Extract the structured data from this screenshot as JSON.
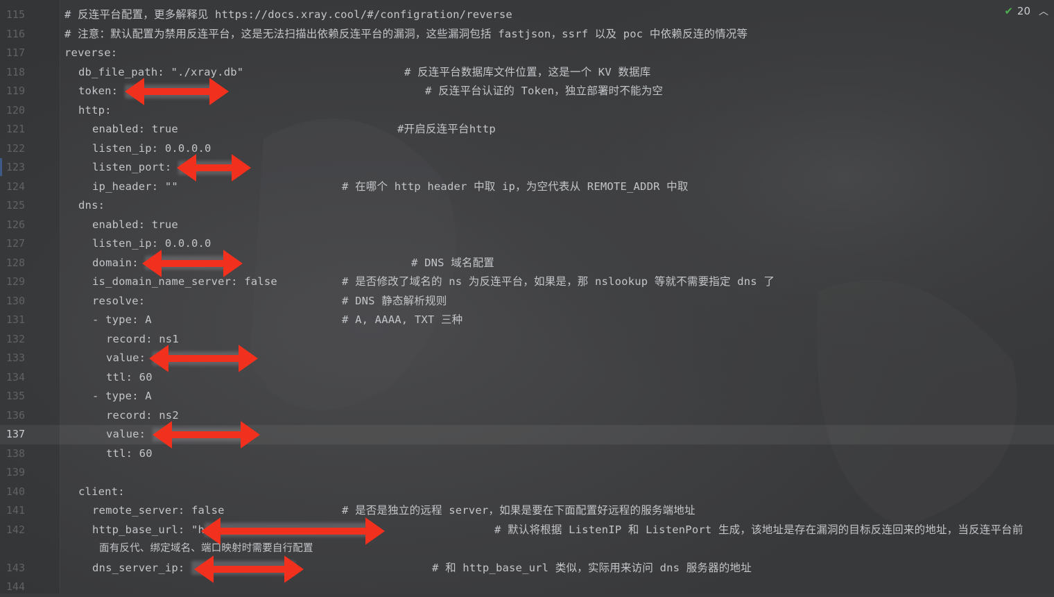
{
  "inspection": {
    "count": "20",
    "check_icon": "check-icon",
    "chevron_icon": "chevron-up-icon"
  },
  "lines": [
    {
      "n": "115",
      "indent": 0,
      "code": "# 反连平台配置，更多解释见 https://docs.xray.cool/#/configration/reverse",
      "comment": "",
      "comment_x": 0
    },
    {
      "n": "116",
      "indent": 0,
      "code": "# 注意：默认配置为禁用反连平台，这是无法扫描出依赖反连平台的漏洞，这些漏洞包括 fastjson，ssrf 以及 poc 中依赖反连的情况等",
      "comment": ""
    },
    {
      "n": "117",
      "indent": 0,
      "code": "reverse:",
      "comment": ""
    },
    {
      "n": "118",
      "indent": 1,
      "code": "db_file_path: \"./xray.db\"",
      "comment": "# 反连平台数据库文件位置，这是一个 KV 数据库"
    },
    {
      "n": "119",
      "indent": 1,
      "code": "token: ",
      "comment": "# 反连平台认证的 Token，独立部署时不能为空"
    },
    {
      "n": "120",
      "indent": 1,
      "code": "http:",
      "comment": ""
    },
    {
      "n": "121",
      "indent": 2,
      "code": "enabled: true",
      "comment": "#开启反连平台http"
    },
    {
      "n": "122",
      "indent": 2,
      "code": "listen_ip: 0.0.0.0",
      "comment": ""
    },
    {
      "n": "123",
      "indent": 2,
      "code": "listen_port: ",
      "comment": ""
    },
    {
      "n": "124",
      "indent": 2,
      "code": "ip_header: \"\"",
      "comment": "# 在哪个 http header 中取 ip，为空代表从 REMOTE_ADDR 中取"
    },
    {
      "n": "125",
      "indent": 1,
      "code": "dns:",
      "comment": ""
    },
    {
      "n": "126",
      "indent": 2,
      "code": "enabled: true",
      "comment": ""
    },
    {
      "n": "127",
      "indent": 2,
      "code": "listen_ip: 0.0.0.0",
      "comment": ""
    },
    {
      "n": "128",
      "indent": 2,
      "code": "domain: ",
      "comment": "# DNS 域名配置"
    },
    {
      "n": "129",
      "indent": 2,
      "code": "is_domain_name_server: false",
      "comment": "# 是否修改了域名的 ns 为反连平台，如果是，那 nslookup 等就不需要指定 dns 了"
    },
    {
      "n": "130",
      "indent": 2,
      "code": "resolve:",
      "comment": "# DNS 静态解析规则"
    },
    {
      "n": "131",
      "indent": 2,
      "code": "- type: A",
      "comment": "# A, AAAA, TXT 三种"
    },
    {
      "n": "132",
      "indent": 3,
      "code": "record: ns1",
      "comment": ""
    },
    {
      "n": "133",
      "indent": 3,
      "code": "value: ",
      "comment": ""
    },
    {
      "n": "134",
      "indent": 3,
      "code": "ttl: 60",
      "comment": ""
    },
    {
      "n": "135",
      "indent": 2,
      "code": "- type: A",
      "comment": ""
    },
    {
      "n": "136",
      "indent": 3,
      "code": "record: ns2",
      "comment": ""
    },
    {
      "n": "137",
      "indent": 3,
      "code": "value: ",
      "comment": ""
    },
    {
      "n": "138",
      "indent": 3,
      "code": "ttl: 60",
      "comment": ""
    },
    {
      "n": "139",
      "indent": 0,
      "code": "",
      "comment": ""
    },
    {
      "n": "140",
      "indent": 1,
      "code": "client:",
      "comment": ""
    },
    {
      "n": "141",
      "indent": 2,
      "code": "remote_server: false",
      "comment": "# 是否是独立的远程 server，如果是要在下面配置好远程的服务端地址"
    },
    {
      "n": "142",
      "indent": 2,
      "code": "http_base_url: \"h",
      "comment": "# 默认将根据 ListenIP 和 ListenPort 生成，该地址是存在漏洞的目标反连回来的地址，当反连平台前"
    },
    {
      "n": "",
      "indent": 0,
      "code": "",
      "comment": "面有反代、绑定域名、端口映射时需要自行配置"
    },
    {
      "n": "143",
      "indent": 2,
      "code": "dns_server_ip: ",
      "comment": "# 和 http_base_url 类似，实际用来访问 dns 服务器的地址"
    },
    {
      "n": "144",
      "indent": 0,
      "code": "",
      "comment": ""
    }
  ],
  "current_line": "137"
}
